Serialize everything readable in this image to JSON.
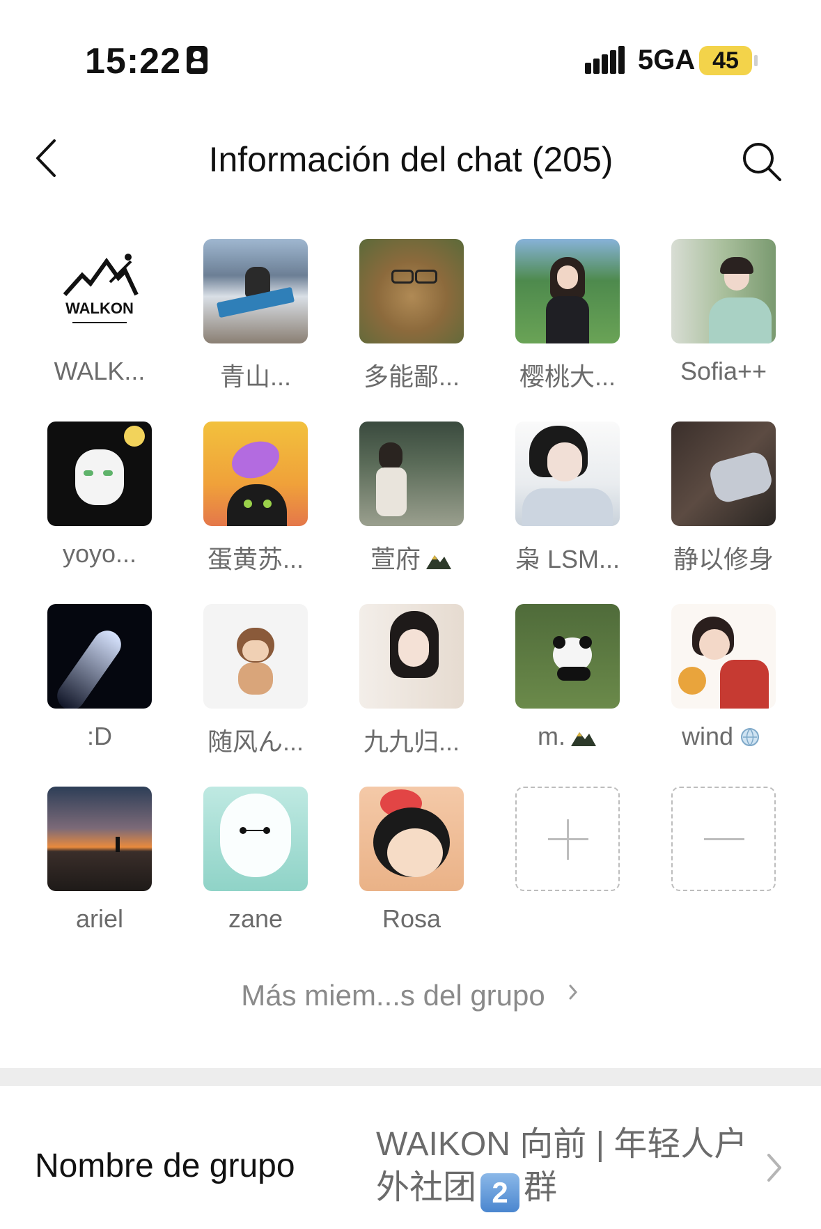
{
  "status_bar": {
    "time": "15:22",
    "network": "5GA",
    "battery": "45",
    "battery_color": "#f3d34a"
  },
  "nav": {
    "title": "Información del chat (205)",
    "back_icon": "chevron-left-icon",
    "search_icon": "search-icon"
  },
  "members": [
    {
      "name": "WALK..."
    },
    {
      "name": "青山..."
    },
    {
      "name": "多能鄙..."
    },
    {
      "name": "樱桃大..."
    },
    {
      "name": "Sofia++"
    },
    {
      "name": "yoyo..."
    },
    {
      "name": "蛋黄苏..."
    },
    {
      "name": "萱府",
      "badge": "mountain-icon"
    },
    {
      "name": "枭 LSM..."
    },
    {
      "name": "静以修身"
    },
    {
      "name": ":D"
    },
    {
      "name": "随风ん..."
    },
    {
      "name": "九九归..."
    },
    {
      "name": "m.",
      "badge": "mountain-icon"
    },
    {
      "name": "wind",
      "badge": "globe-icon"
    },
    {
      "name": "ariel"
    },
    {
      "name": "zane"
    },
    {
      "name": "Rosa"
    }
  ],
  "actions": {
    "add_icon": "plus-icon",
    "remove_icon": "minus-icon"
  },
  "more_members": "Más miem...s del grupo",
  "group_name": {
    "label": "Nombre de grupo",
    "value_line1": "WAIKON 向前 | 年轻人户",
    "value_line2_prefix": "外社团",
    "value_keycap": "2",
    "value_line2_suffix": "群"
  }
}
